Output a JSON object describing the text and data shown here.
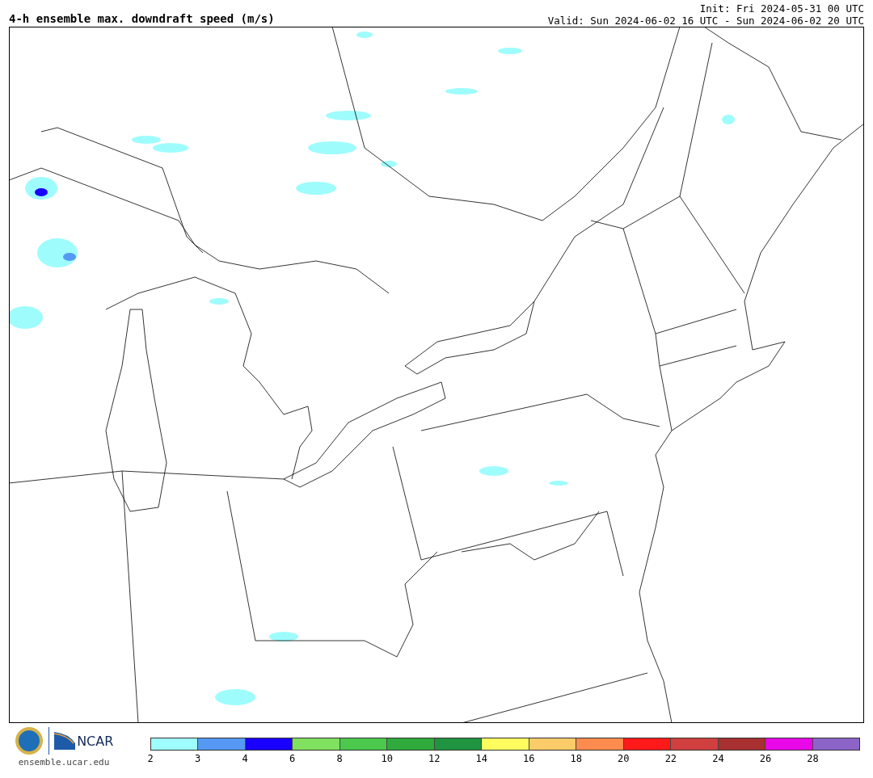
{
  "title": "4-h ensemble max. downdraft speed (m/s)",
  "init": "Init: Fri 2024-05-31 00 UTC",
  "valid": "Valid: Sun 2024-06-02 16 UTC - Sun 2024-06-02 20 UTC",
  "logo": {
    "org": "NCAR",
    "url": "ensemble.ucar.edu"
  },
  "colorbar": {
    "segments": [
      {
        "color": "#9ffcfc"
      },
      {
        "color": "#5599f5"
      },
      {
        "color": "#1a00ff"
      },
      {
        "color": "#80e060"
      },
      {
        "color": "#4cc84c"
      },
      {
        "color": "#30aa3c"
      },
      {
        "color": "#209440"
      },
      {
        "color": "#fffc60"
      },
      {
        "color": "#fccb6a"
      },
      {
        "color": "#fd8c4e"
      },
      {
        "color": "#fe1a1a"
      },
      {
        "color": "#d04040"
      },
      {
        "color": "#a83030"
      },
      {
        "color": "#e808e8"
      },
      {
        "color": "#8c64c8"
      }
    ],
    "ticks": [
      "2",
      "3",
      "4",
      "6",
      "8",
      "10",
      "12",
      "14",
      "16",
      "18",
      "20",
      "22",
      "24",
      "26",
      "28"
    ]
  }
}
